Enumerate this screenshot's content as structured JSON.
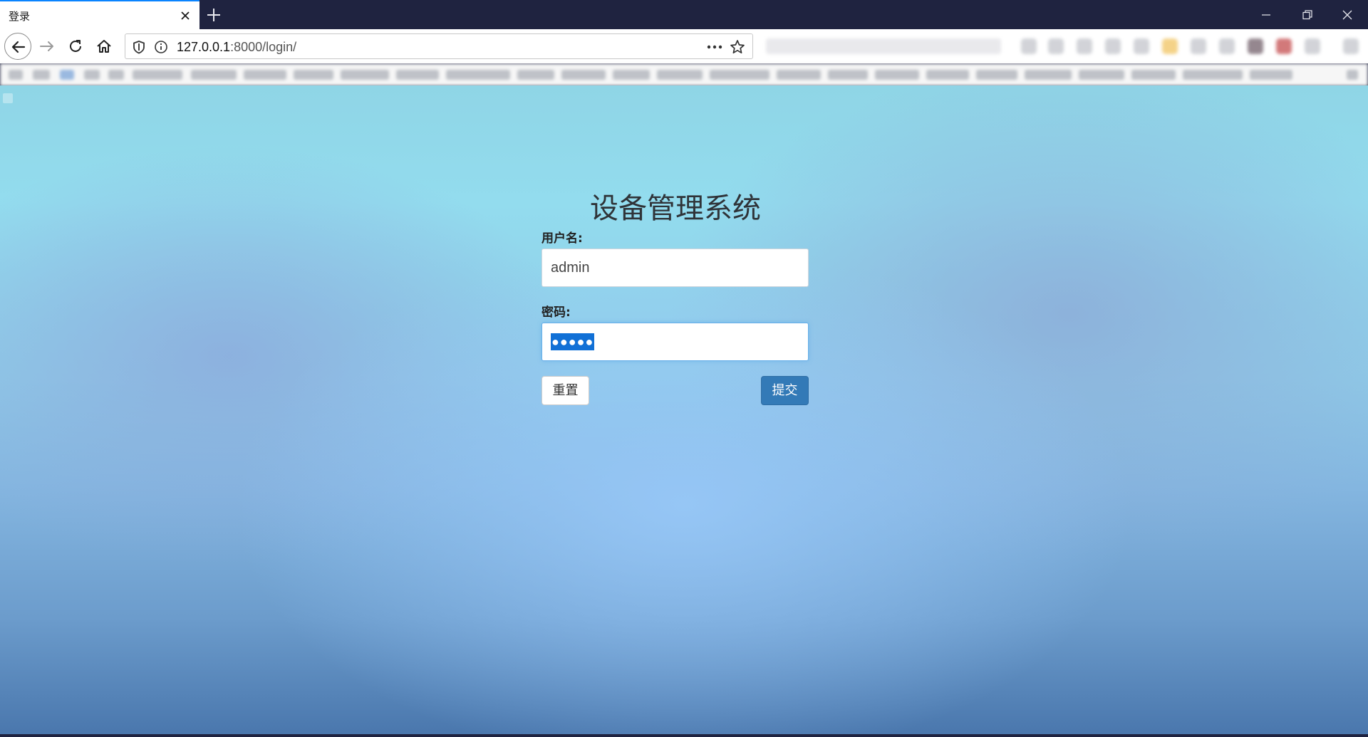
{
  "browser": {
    "tab": {
      "title": "登录"
    },
    "url": {
      "host": "127.0.0.1",
      "rest": ":8000/login/"
    }
  },
  "login": {
    "title": "设备管理系统",
    "username_label": "用户名:",
    "username_value": "admin",
    "password_label": "密码:",
    "password_mask": "●●●●●",
    "reset_label": "重置",
    "submit_label": "提交"
  },
  "colors": {
    "submit_button": "#337ab7",
    "selection_highlight": "#1170d6",
    "window_chrome": "#1f2340"
  }
}
